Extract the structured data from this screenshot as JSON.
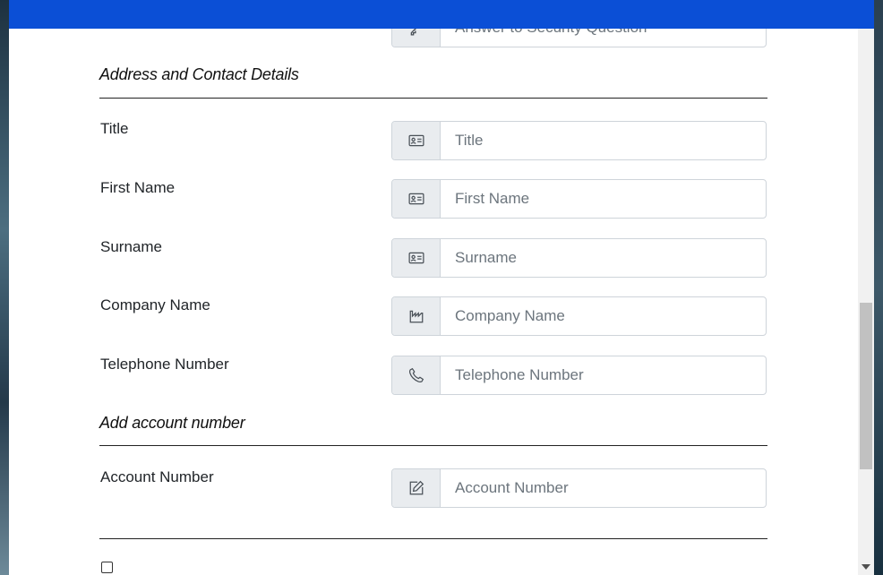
{
  "header": {
    "color": "#0b4fd6"
  },
  "partial_field": {
    "placeholder": "Answer to Security Question",
    "icon": "key-icon"
  },
  "sections": {
    "address": {
      "heading": "Address and Contact Details"
    },
    "account": {
      "heading": "Add account number"
    }
  },
  "fields": {
    "title": {
      "label": "Title",
      "placeholder": "Title",
      "value": "",
      "icon": "id-card-icon"
    },
    "first_name": {
      "label": "First Name",
      "placeholder": "First Name",
      "value": "",
      "icon": "id-card-icon"
    },
    "surname": {
      "label": "Surname",
      "placeholder": "Surname",
      "value": "",
      "icon": "id-card-icon"
    },
    "company_name": {
      "label": "Company Name",
      "placeholder": "Company Name",
      "value": "",
      "icon": "factory-icon"
    },
    "telephone": {
      "label": "Telephone Number",
      "placeholder": "Telephone Number",
      "value": "",
      "icon": "phone-icon"
    },
    "account_number": {
      "label": "Account Number",
      "placeholder": "Account Number",
      "value": "",
      "icon": "edit-icon"
    }
  },
  "checkbox": {
    "checked": false
  }
}
